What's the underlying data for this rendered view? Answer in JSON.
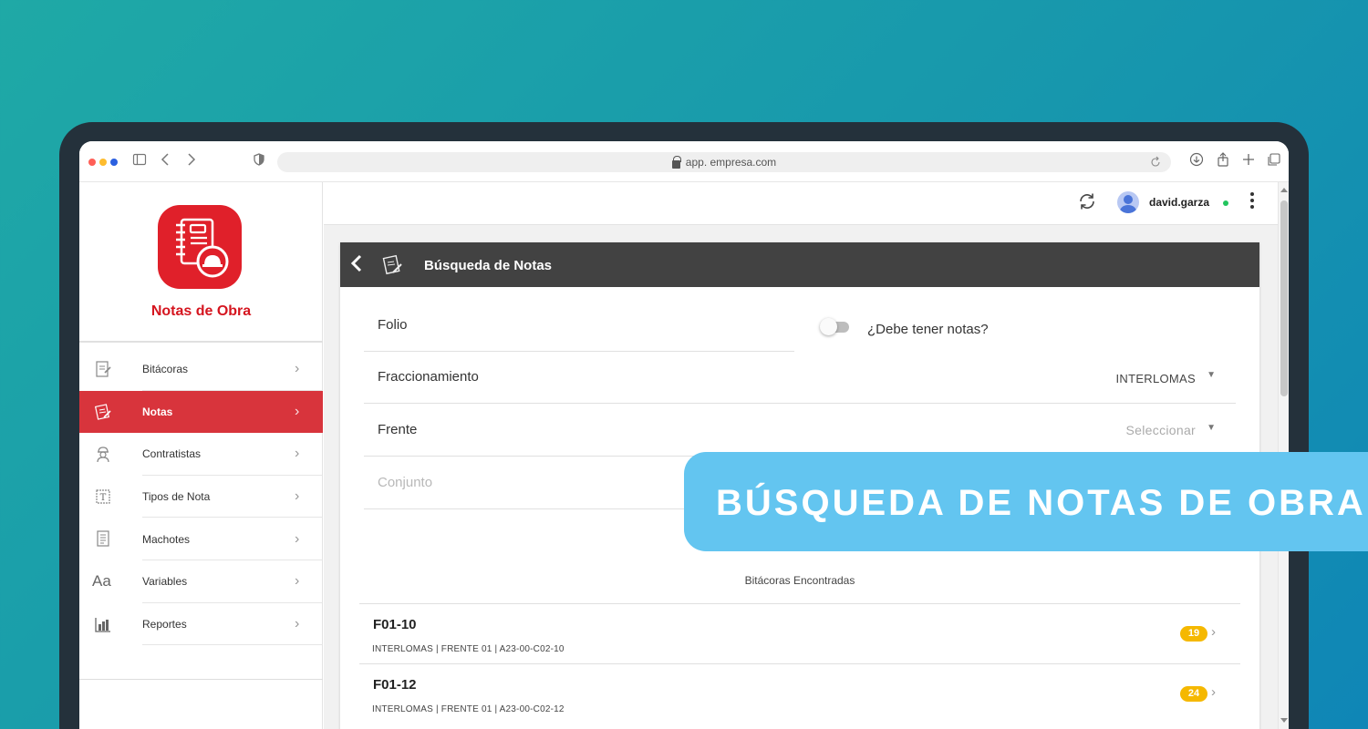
{
  "browser": {
    "url": "app. empresa.com",
    "traffic_colors": [
      "#ff5f57",
      "#febc2e",
      "#2b60e0"
    ]
  },
  "app": {
    "name": "Notas de Obra",
    "brand_color": "#e0202a"
  },
  "sidebar": {
    "items": [
      {
        "label": "Bitácoras",
        "icon": "notebook-edit-icon",
        "active": false
      },
      {
        "label": "Notas",
        "icon": "notes-icon",
        "active": true
      },
      {
        "label": "Contratistas",
        "icon": "worker-icon",
        "active": false
      },
      {
        "label": "Tipos de Nota",
        "icon": "text-box-icon",
        "active": false
      },
      {
        "label": "Machotes",
        "icon": "template-icon",
        "active": false
      },
      {
        "label": "Variables",
        "icon": "font-aa-icon",
        "active": false
      },
      {
        "label": "Reportes",
        "icon": "bar-chart-icon",
        "active": false
      }
    ]
  },
  "topbar": {
    "username": "david.garza",
    "status_color": "#22c55e"
  },
  "search": {
    "title": "Búsqueda de Notas",
    "folio_label": "Folio",
    "toggle_label": "¿Debe tener notas?",
    "fraccionamiento_label": "Fraccionamiento",
    "fraccionamiento_value": "INTERLOMAS",
    "frente_label": "Frente",
    "frente_placeholder": "Seleccionar",
    "conjunto_label": "Conjunto",
    "results_title": "Bitácoras Encontradas",
    "results": [
      {
        "title": "F01-10",
        "subtitle": "INTERLOMAS | FRENTE 01 | A23-00-C02-10",
        "count": "19"
      },
      {
        "title": "F01-12",
        "subtitle": "INTERLOMAS | FRENTE 01 | A23-00-C02-12",
        "count": "24"
      }
    ]
  },
  "banner": {
    "text": "BÚSQUEDA DE NOTAS DE OBRA",
    "color": "#63c5f0"
  }
}
